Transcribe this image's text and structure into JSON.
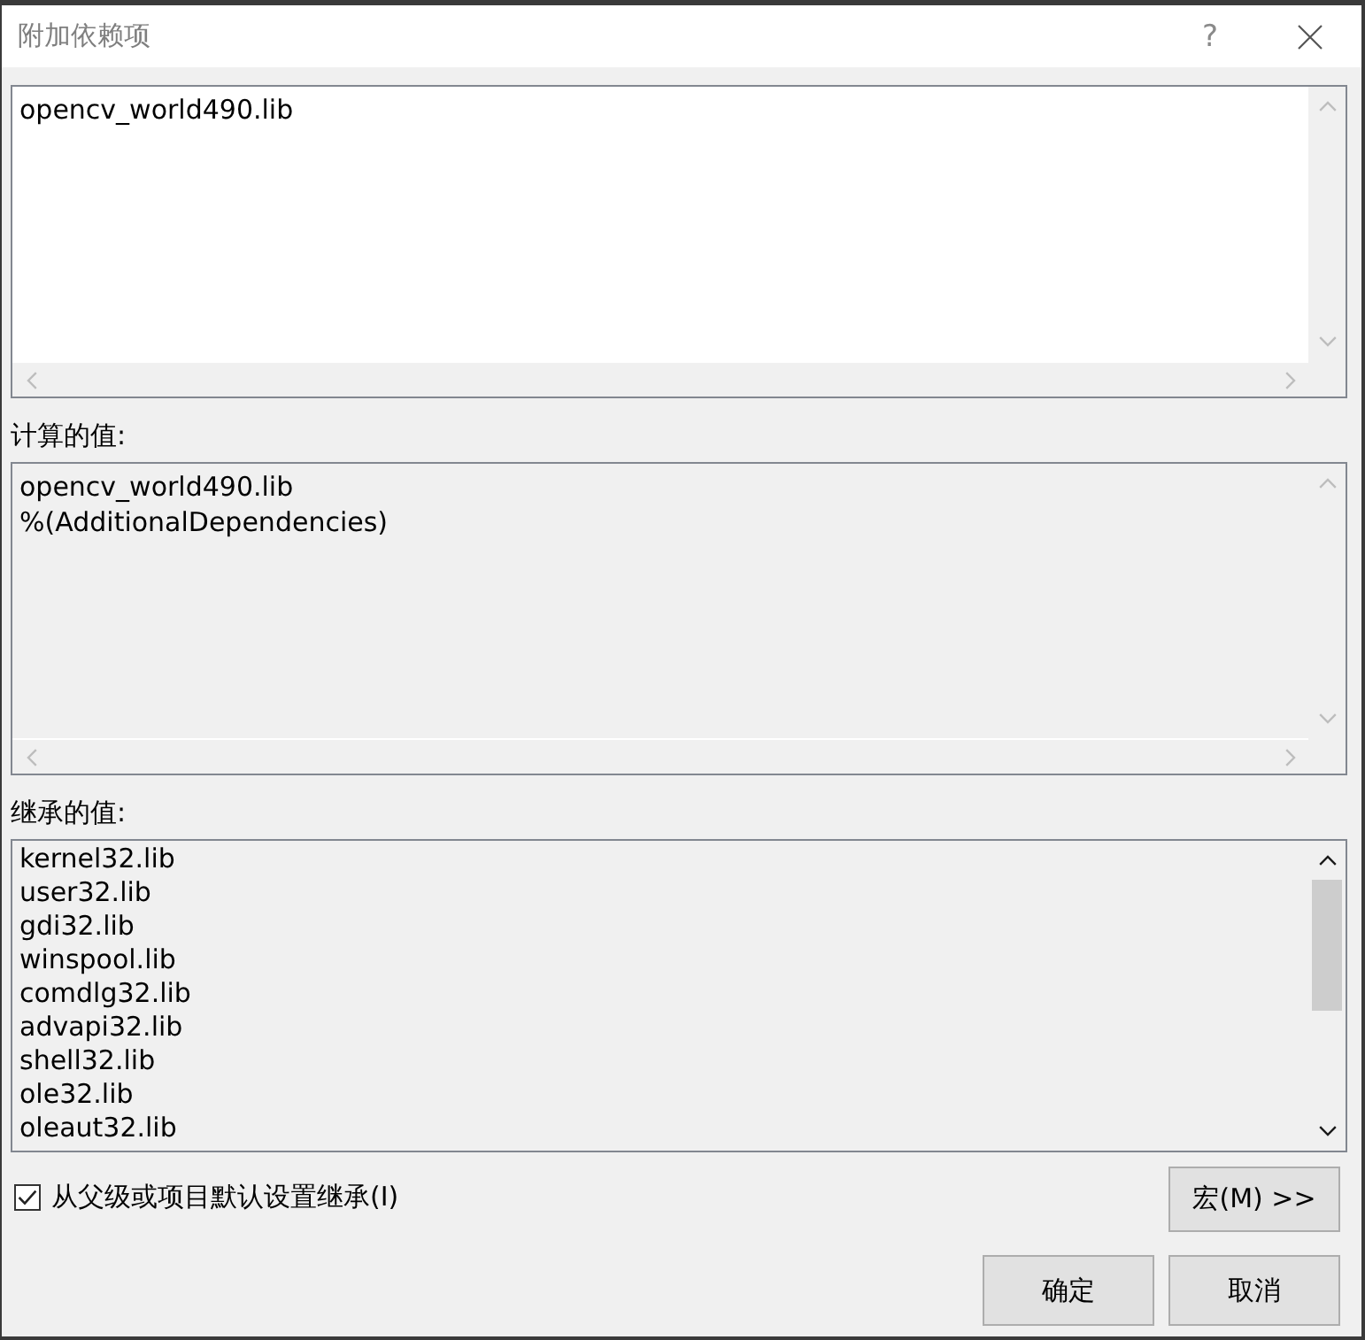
{
  "window": {
    "title": "附加依赖项",
    "help": "?"
  },
  "value_box": {
    "lines": [
      "opencv_world490.lib"
    ],
    "editable": true,
    "scroll_enabled": false,
    "horizontal_scrollbar": true
  },
  "computed": {
    "label": "计算的值:",
    "lines": [
      "opencv_world490.lib",
      "%(AdditionalDependencies)"
    ],
    "editable": false,
    "scroll_enabled": false,
    "horizontal_scrollbar": true
  },
  "inherited": {
    "label": "继承的值:",
    "lines": [
      "kernel32.lib",
      "user32.lib",
      "gdi32.lib",
      "winspool.lib",
      "comdlg32.lib",
      "advapi32.lib",
      "shell32.lib",
      "ole32.lib",
      "oleaut32.lib"
    ],
    "editable": false,
    "scroll_enabled": true,
    "horizontal_scrollbar": false
  },
  "inherit_checkbox": {
    "label": "从父级或项目默认设置继承(I)",
    "checked": true
  },
  "macro_button": "宏(M) >>",
  "buttons": [
    "确定",
    "取消"
  ]
}
